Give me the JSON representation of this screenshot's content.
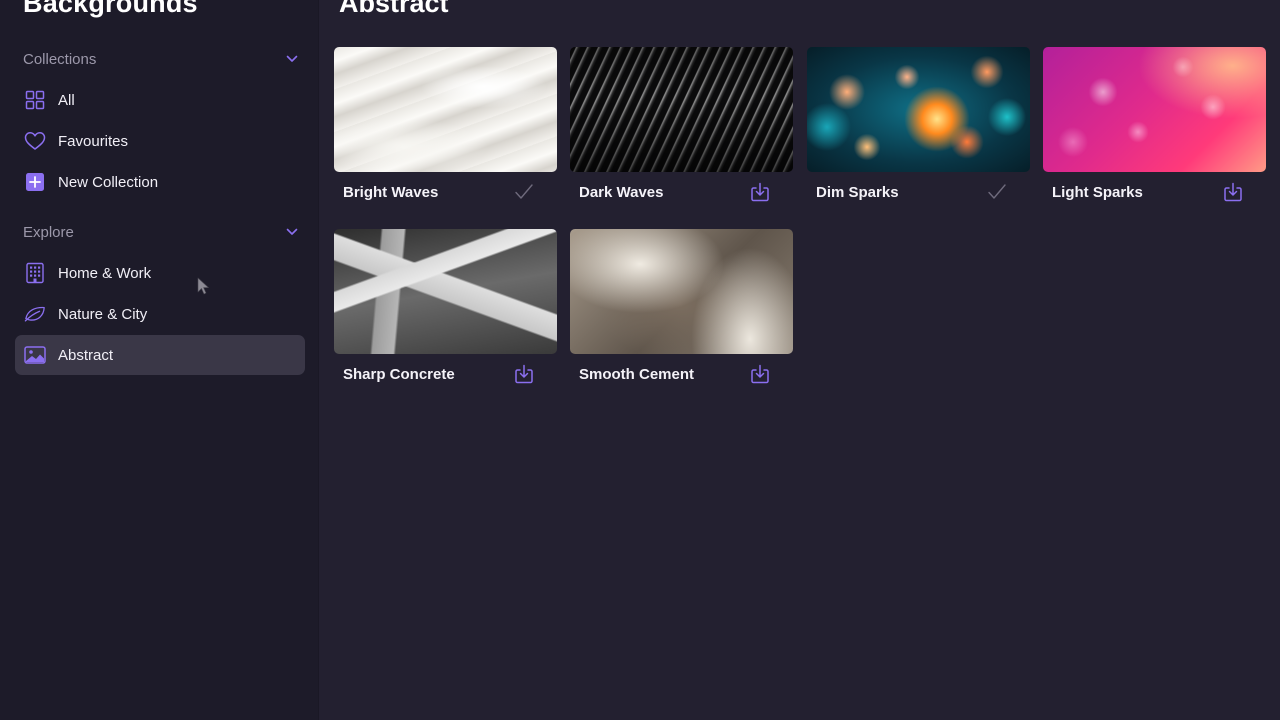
{
  "app": {
    "title": "Backgrounds"
  },
  "sidebar": {
    "collections": {
      "header": "Collections",
      "items": [
        {
          "label": "All",
          "icon": "grid-icon"
        },
        {
          "label": "Favourites",
          "icon": "heart-icon"
        },
        {
          "label": "New Collection",
          "icon": "plus-square-icon"
        }
      ]
    },
    "explore": {
      "header": "Explore",
      "items": [
        {
          "label": "Home & Work",
          "icon": "building-icon"
        },
        {
          "label": "Nature & City",
          "icon": "leaf-icon"
        },
        {
          "label": "Abstract",
          "icon": "image-icon",
          "selected": true
        }
      ]
    }
  },
  "main": {
    "title": "Abstract",
    "wallpapers": [
      {
        "name": "Bright Waves",
        "status": "downloaded"
      },
      {
        "name": "Dark Waves",
        "status": "download"
      },
      {
        "name": "Dim Sparks",
        "status": "downloaded"
      },
      {
        "name": "Light Sparks",
        "status": "download"
      },
      {
        "name": "Sharp Concrete",
        "status": "download"
      },
      {
        "name": "Smooth Cement",
        "status": "download"
      }
    ]
  },
  "colors": {
    "accent": "#8b6ff0",
    "sidebar_bg": "#1d1b29",
    "main_bg": "#232030",
    "selected_bg": "#3a3747",
    "muted_text": "#9c98aa"
  }
}
